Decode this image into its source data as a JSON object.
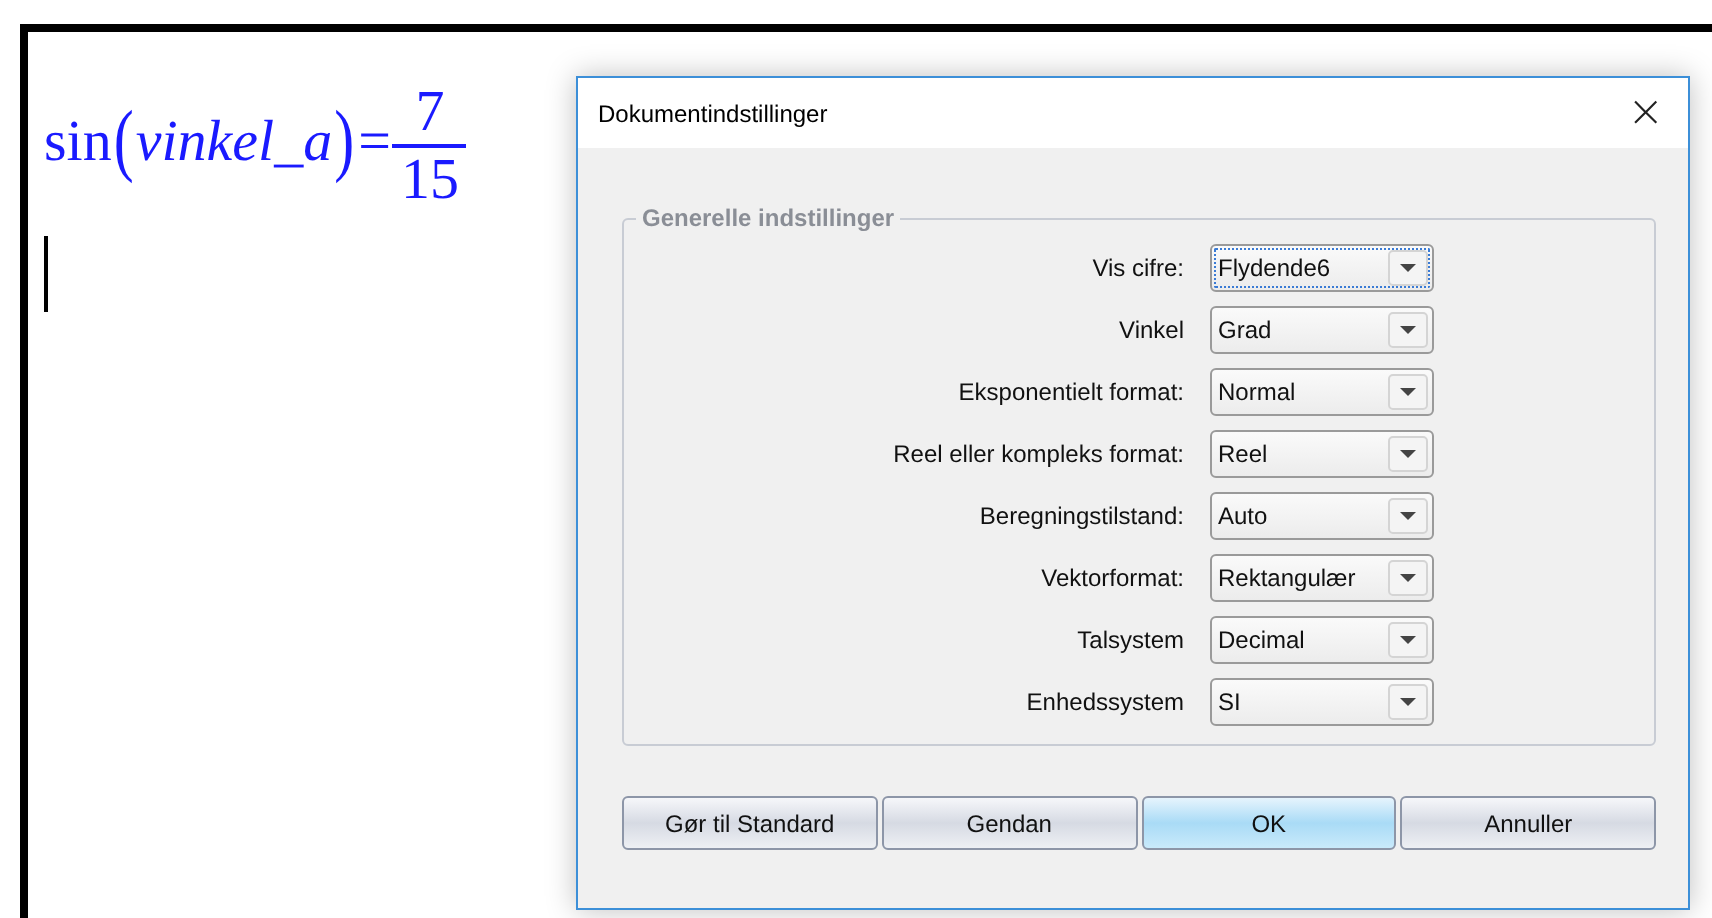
{
  "document": {
    "formula": {
      "function": "sin",
      "open_paren": "(",
      "argument": "vinkel_a",
      "close_paren": ")",
      "equals": "=",
      "numerator": "7",
      "denominator": "15"
    },
    "cursor": true
  },
  "dialog": {
    "title": "Dokumentindstillinger",
    "close": "×",
    "group": {
      "title": "Generelle indstillinger",
      "settings": [
        {
          "label": "Vis cifre:",
          "value": "Flydende6",
          "focused": true
        },
        {
          "label": "Vinkel",
          "value": "Grad",
          "focused": false
        },
        {
          "label": "Eksponentielt format:",
          "value": "Normal",
          "focused": false
        },
        {
          "label": "Reel eller kompleks format:",
          "value": "Reel",
          "focused": false
        },
        {
          "label": "Beregningstilstand:",
          "value": "Auto",
          "focused": false
        },
        {
          "label": "Vektorformat:",
          "value": "Rektangulær",
          "focused": false
        },
        {
          "label": "Talsystem",
          "value": "Decimal",
          "focused": false
        },
        {
          "label": "Enhedssystem",
          "value": "SI",
          "focused": false
        }
      ]
    },
    "buttons": [
      {
        "label": "Gør til Standard",
        "default": false
      },
      {
        "label": "Gendan",
        "default": false
      },
      {
        "label": "OK",
        "default": true
      },
      {
        "label": "Annuller",
        "default": false
      }
    ]
  }
}
